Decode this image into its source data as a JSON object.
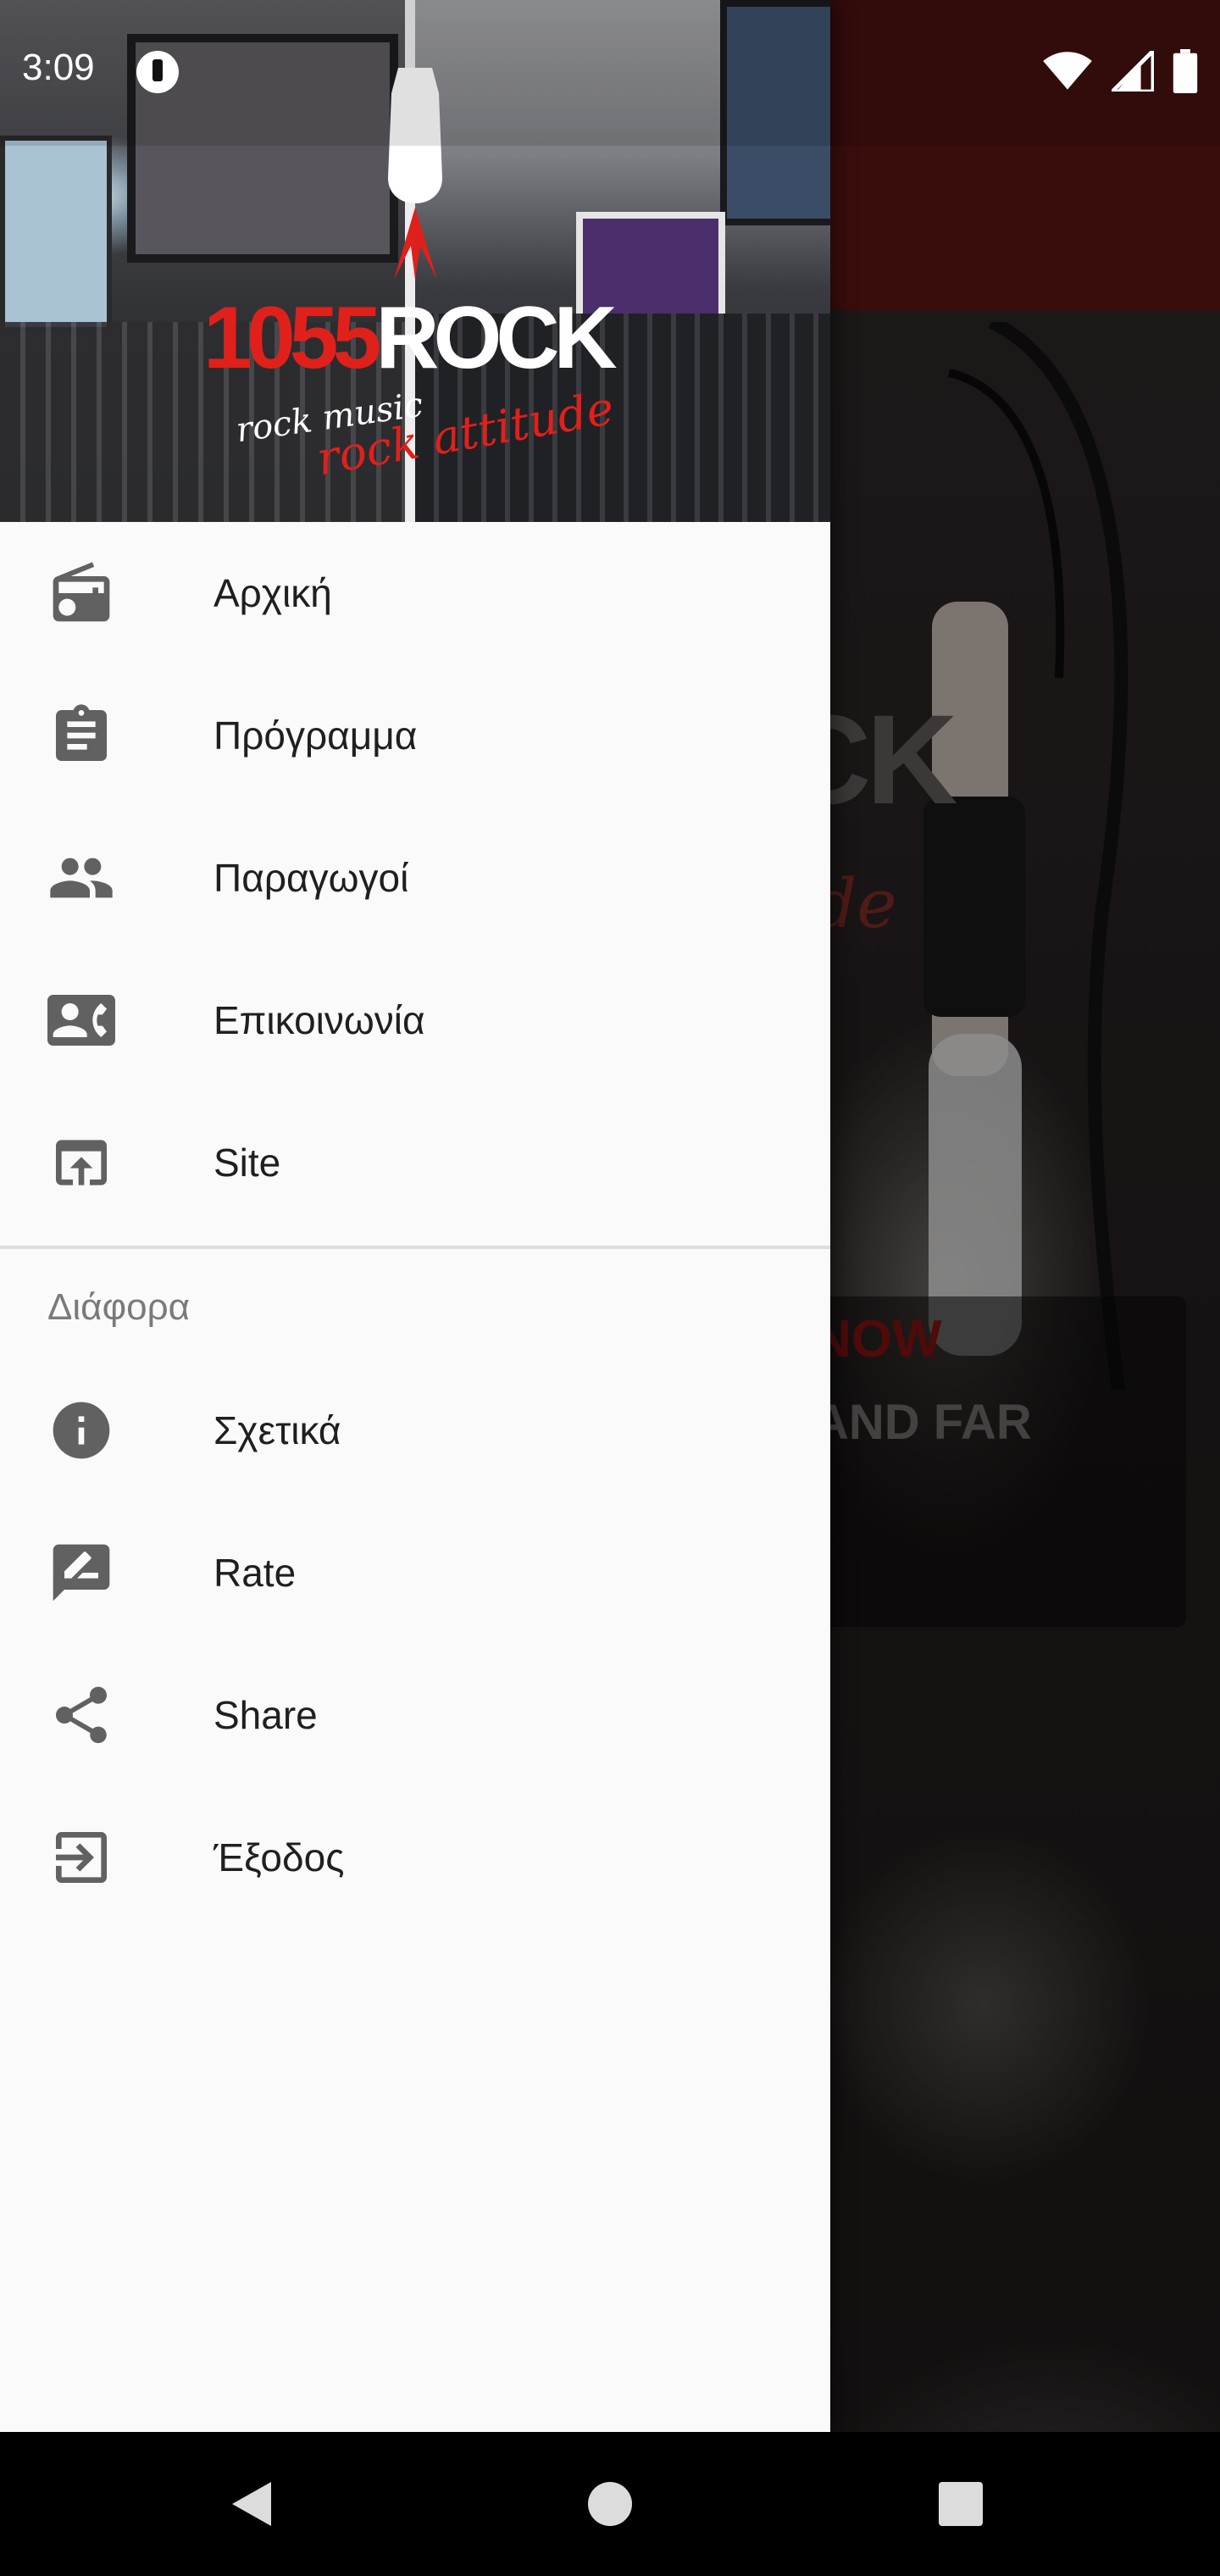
{
  "status_bar": {
    "time": "3:09"
  },
  "drawer": {
    "header": {
      "logo_number": "1055",
      "logo_name": "ROCK",
      "tagline_1": "rock music",
      "tagline_2": "rock attitude"
    },
    "primary_items": [
      {
        "label": "Αρχική",
        "icon": "radio-icon"
      },
      {
        "label": "Πρόγραμμα",
        "icon": "clipboard-icon"
      },
      {
        "label": "Παραγωγοί",
        "icon": "people-icon"
      },
      {
        "label": "Επικοινωνία",
        "icon": "contact-phone-icon"
      },
      {
        "label": "Site",
        "icon": "open-in-browser-icon"
      }
    ],
    "section_title": "Διάφορα",
    "secondary_items": [
      {
        "label": "Σχετικά",
        "icon": "info-icon"
      },
      {
        "label": "Rate",
        "icon": "rate-review-icon"
      },
      {
        "label": "Share",
        "icon": "share-icon"
      },
      {
        "label": "Έξοδος",
        "icon": "exit-icon"
      }
    ]
  },
  "background_app": {
    "logo_fragment": "CK",
    "logo_script_fragment": "de",
    "now_label": "NOW",
    "now_title": "AND FAR"
  },
  "colors": {
    "accent": "#e0201b",
    "toolbar": "#5a1414",
    "drawer_background": "#fafafa",
    "icon": "#616161"
  }
}
